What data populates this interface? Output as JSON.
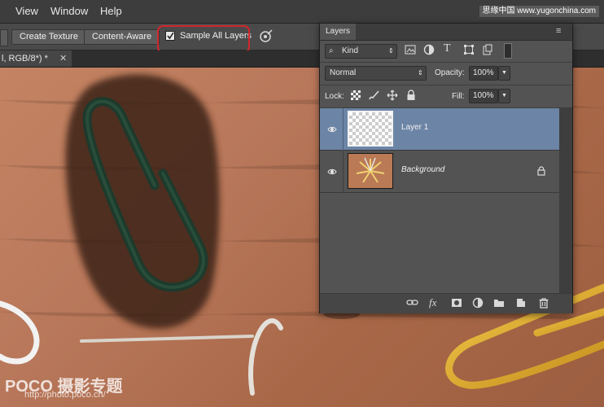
{
  "menubar": {
    "items": [
      "View",
      "Window",
      "Help"
    ],
    "watermark": "思缘中国 www.yugonchina.com"
  },
  "options": {
    "create_texture": "Create Texture",
    "content_aware": "Content-Aware",
    "sample_all_layers": "Sample All Layers",
    "sample_all_layers_checked": true
  },
  "document": {
    "tab_label": "l, RGB/8*) *"
  },
  "layers_panel": {
    "title": "Layers",
    "filter_kind": "Kind",
    "blend_mode": "Normal",
    "opacity_label": "Opacity:",
    "opacity_value": "100%",
    "lock_label": "Lock:",
    "fill_label": "Fill:",
    "fill_value": "100%",
    "layers": [
      {
        "name": "Layer 1",
        "selected": true,
        "locked": false
      },
      {
        "name": "Background",
        "selected": false,
        "locked": true
      }
    ],
    "bottom_icons": [
      "link-icon",
      "fx-icon",
      "mask-icon",
      "adjustment-icon",
      "folder-icon",
      "new-layer-icon",
      "trash-icon"
    ],
    "fx_label": "fx"
  },
  "watermark": {
    "brand": "POCO 摄影专题",
    "url": "http://photo.poco.cn/"
  },
  "colors": {
    "selection_highlight": "#d2262b",
    "selected_layer": "#6c85a6"
  }
}
